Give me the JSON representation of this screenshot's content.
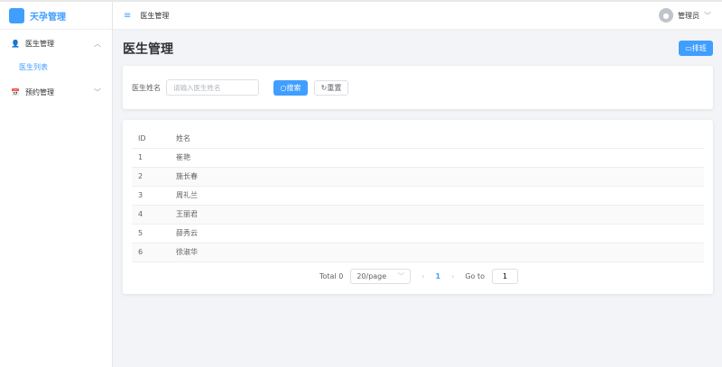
{
  "app": {
    "name": "天孕管理"
  },
  "sidebar": {
    "items": [
      {
        "label": "医生管理",
        "icon": "user-icon",
        "expanded": true,
        "children": [
          {
            "label": "医生列表",
            "active": true
          }
        ]
      },
      {
        "label": "预约管理",
        "icon": "calendar-icon",
        "expanded": false
      }
    ]
  },
  "header": {
    "breadcrumb": "医生管理",
    "user": "管理员"
  },
  "page": {
    "title": "医生管理",
    "schedule_button": "排班"
  },
  "search": {
    "label": "医生姓名",
    "value": "",
    "placeholder": "请输入医生姓名",
    "search_button": "搜索",
    "reset_button": "重置"
  },
  "table": {
    "columns": [
      "ID",
      "姓名"
    ],
    "rows": [
      {
        "id": "1",
        "name": "崔艳"
      },
      {
        "id": "2",
        "name": "施长春"
      },
      {
        "id": "3",
        "name": "周礼兰"
      },
      {
        "id": "4",
        "name": "王丽君"
      },
      {
        "id": "5",
        "name": "薛秀云"
      },
      {
        "id": "6",
        "name": "徐淑华"
      }
    ]
  },
  "pagination": {
    "total": "Total 0",
    "page_size": "20/page",
    "current": "1",
    "goto_label": "Go to",
    "goto_value": "1"
  }
}
